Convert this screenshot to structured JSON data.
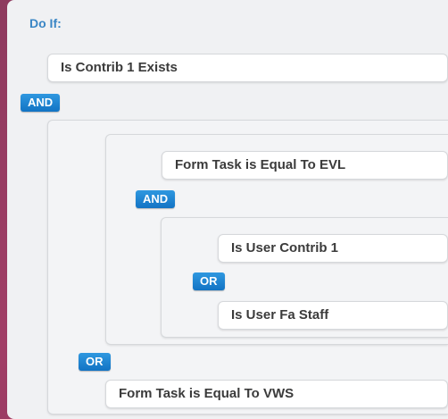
{
  "header": {
    "title": "Do If:"
  },
  "conditions": {
    "top": "Is Contrib 1 Exists",
    "form_evl": "Form Task is Equal To EVL",
    "user_contrib": "Is User Contrib 1",
    "user_fa_staff": "Is User Fa Staff",
    "form_vws": "Form Task is Equal To VWS"
  },
  "operators": {
    "root": "AND",
    "group_evl": "AND",
    "group_user": "OR",
    "group_outer": "OR"
  },
  "colors": {
    "accent": "#1a7fd4",
    "title": "#3a86c5",
    "background": "#a13e66"
  }
}
